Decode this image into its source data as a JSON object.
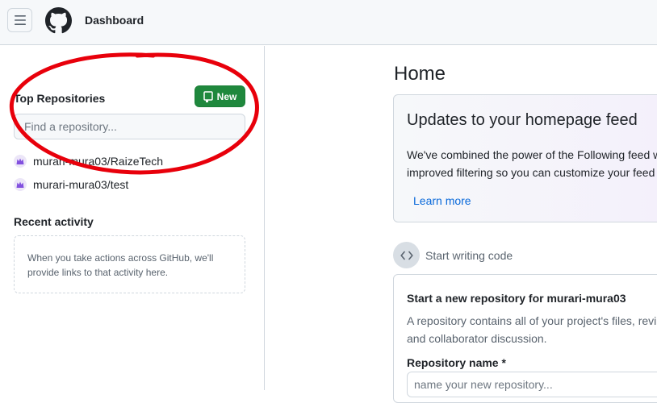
{
  "header": {
    "menu_icon": "hamburger-icon",
    "logo_icon": "github-mark-icon",
    "title": "Dashboard"
  },
  "sidebar": {
    "top_repos_heading": "Top Repositories",
    "new_button_label": "New",
    "new_button_icon": "repo-icon",
    "search_placeholder": "Find a repository...",
    "repositories": [
      {
        "name": "murari-mura03/RaizeTech",
        "avatar_icon": "user-avatar-icon"
      },
      {
        "name": "murari-mura03/test",
        "avatar_icon": "user-avatar-icon"
      }
    ],
    "recent_heading": "Recent activity",
    "recent_empty_text": "When you take actions across GitHub, we'll provide links to that activity here."
  },
  "main": {
    "title": "Home",
    "feed_card": {
      "title": "Updates to your homepage feed",
      "line1": "We've combined the power of the Following feed w",
      "line2": "improved filtering so you can customize your feed",
      "link": "Learn more"
    },
    "section_label": "Start writing code",
    "section_icon": "code-icon",
    "new_repo": {
      "title": "Start a new repository for murari-mura03",
      "line1": "A repository contains all of your project's files, revi",
      "line2": "and collaborator discussion.",
      "name_label": "Repository name *",
      "name_placeholder": "name your new repository..."
    }
  },
  "colors": {
    "primary_button": "#1f883d",
    "link": "#0969da",
    "annotation_circle": "#e8000b"
  }
}
